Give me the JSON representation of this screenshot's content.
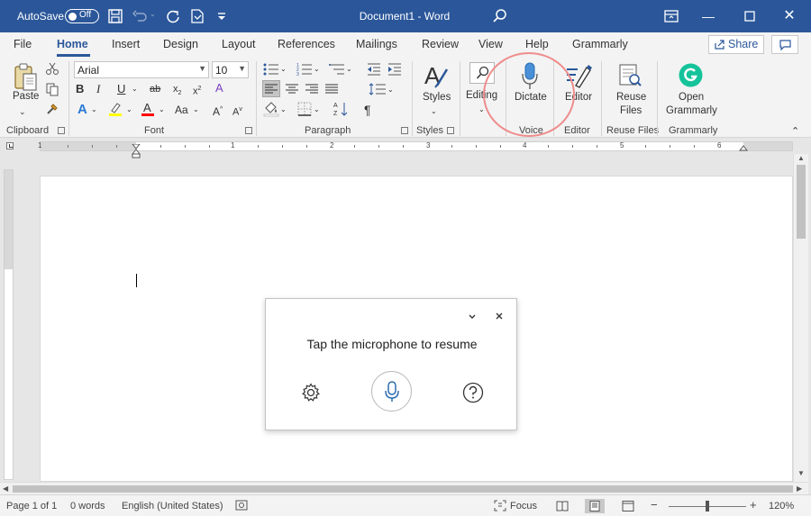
{
  "titlebar": {
    "autosave_label": "AutoSave",
    "autosave_state": "Off",
    "title": "Document1  -  Word",
    "icons": [
      "save-icon",
      "undo-icon",
      "redo-icon",
      "touch-mode-icon",
      "customize-qat-icon",
      "search-icon",
      "ribbon-display-icon",
      "minimize-icon",
      "restore-icon",
      "close-icon"
    ]
  },
  "tabs": {
    "items": [
      "File",
      "Home",
      "Insert",
      "Design",
      "Layout",
      "References",
      "Mailings",
      "Review",
      "View",
      "Help",
      "Grammarly"
    ],
    "active": "Home",
    "share_label": "Share"
  },
  "ribbon": {
    "clipboard": {
      "paste_label": "Paste",
      "group_label": "Clipboard"
    },
    "font": {
      "font_name": "Arial",
      "font_size": "10",
      "group_label": "Font",
      "highlight_color": "#ffff00",
      "font_color": "#ff0000"
    },
    "paragraph": {
      "group_label": "Paragraph"
    },
    "styles": {
      "label": "Styles",
      "group_label": "Styles"
    },
    "editing": {
      "label": "Editing"
    },
    "voice": {
      "dictate_label": "Dictate",
      "group_label": "Voice"
    },
    "editor": {
      "label": "Editor",
      "group_label": "Editor"
    },
    "reuse": {
      "label_line1": "Reuse",
      "label_line2": "Files",
      "group_label": "Reuse Files"
    },
    "grammarly": {
      "label_line1": "Open",
      "label_line2": "Grammarly",
      "group_label": "Grammarly",
      "brand_color": "#15c39a"
    }
  },
  "ruler": {
    "numbers": [
      "1",
      "1",
      "2",
      "3",
      "4",
      "5",
      "6"
    ]
  },
  "dictation": {
    "message": "Tap the microphone to resume",
    "icons": [
      "collapse-icon",
      "close-icon",
      "settings-icon",
      "microphone-icon",
      "help-icon"
    ]
  },
  "statusbar": {
    "page": "Page 1 of 1",
    "words": "0 words",
    "language": "English (United States)",
    "focus_label": "Focus",
    "zoom": "120%",
    "zoom_minus": "−",
    "zoom_plus": "+"
  },
  "colors": {
    "accent": "#2b579a",
    "annotation": "#ef8c8c"
  }
}
